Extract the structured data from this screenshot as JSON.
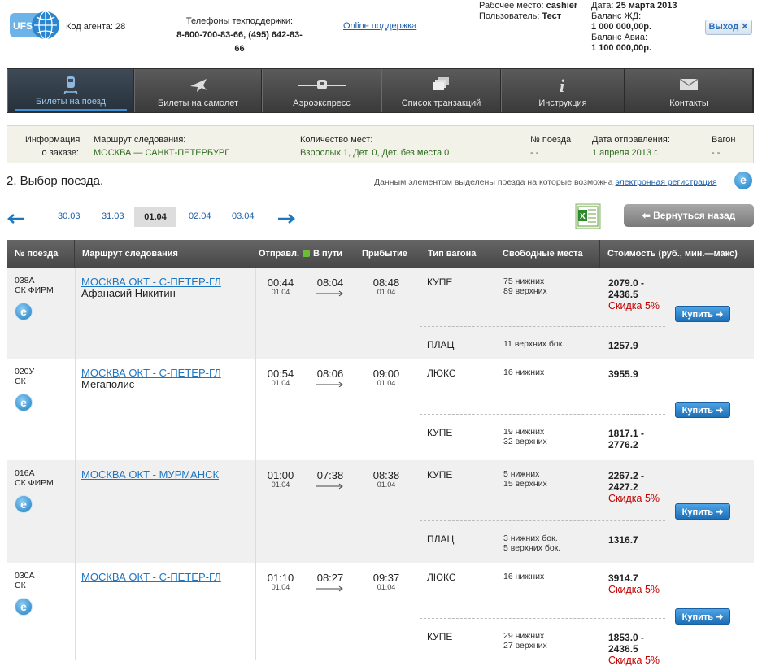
{
  "header": {
    "agent_code": "Код агента: 28",
    "phones_title": "Телефоны техподдержки:",
    "phones": "8-800-700-83-66, (495) 642-83-66",
    "online_support": "Online поддержка",
    "workplace_label": "Рабочее место:",
    "workplace_value": "cashier",
    "user_label": "Пользователь:",
    "user_value": "Тест",
    "date_label": "Дата:",
    "date_value": "25 марта 2013",
    "rail_balance_label": "Баланс ЖД:",
    "rail_balance_value": "1 000 000,00р.",
    "avia_balance_label": "Баланс Авиа:",
    "avia_balance_value": "1 100 000,00р.",
    "exit_label": "Выход",
    "logo_text": "UFS"
  },
  "nav": [
    {
      "label": "Билеты на поезд",
      "icon": "train-icon",
      "active": true
    },
    {
      "label": "Билеты на самолет",
      "icon": "plane-icon",
      "active": false
    },
    {
      "label": "Аэроэкспресс",
      "icon": "aeroexpress-icon",
      "active": false
    },
    {
      "label": "Список транзакций",
      "icon": "transactions-icon",
      "active": false
    },
    {
      "label": "Инструкция",
      "icon": "info-icon",
      "active": false
    },
    {
      "label": "Контакты",
      "icon": "mail-icon",
      "active": false
    }
  ],
  "order_info": {
    "label_line1": "Информация",
    "label_line2": "о заказе:",
    "route_label": "Маршрут следования:",
    "route_value": "МОСКВА — САНКТ-ПЕТЕРБУРГ",
    "seats_label": "Количество мест:",
    "seats_value": "Взрослых 1, Дет. 0, Дет. без места 0",
    "train_label": "№ поезда",
    "train_value": "- -",
    "date_label": "Дата отправления:",
    "date_value": "1 апреля 2013 г.",
    "car_label": "Вагон",
    "car_value": "- -"
  },
  "step_title": "2. Выбор поезда.",
  "note_text": "Данным элементом выделены поезда на которые возможна",
  "note_link": "электронная регистрация",
  "dates": [
    "30.03",
    "31.03",
    "01.04",
    "02.04",
    "03.04"
  ],
  "back_button": "Вернуться назад",
  "columns": [
    "№ поезда",
    "Маршрут следования",
    "Отправл.",
    "В пути",
    "Прибытие",
    "Тип вагона",
    "Свободные места",
    "Стоимость (руб., мин.—макс)"
  ],
  "buy_label": "Купить",
  "trains": [
    {
      "num": "038А",
      "cls": "СК ФИРМ",
      "route": "МОСКВА ОКТ - С-ПЕТЕР-ГЛ",
      "name": "Афанасий Никитин",
      "dep": "00:44",
      "dep_date": "01.04",
      "travel": "08:04",
      "arr": "08:48",
      "arr_date": "01.04",
      "cars": [
        {
          "type": "КУПЕ",
          "seats1": "75 нижних",
          "seats2": "89 верхних",
          "price1": "2079.0 -",
          "price2": "2436.5",
          "discount": "Скидка 5%"
        },
        {
          "type": "ПЛАЦ",
          "seats1": "11 верхних бок.",
          "seats2": "",
          "price1": "1257.9",
          "price2": "",
          "discount": ""
        }
      ]
    },
    {
      "num": "020У",
      "cls": "СК",
      "route": "МОСКВА ОКТ - С-ПЕТЕР-ГЛ",
      "name": "Мегаполис",
      "dep": "00:54",
      "dep_date": "01.04",
      "travel": "08:06",
      "arr": "09:00",
      "arr_date": "01.04",
      "cars": [
        {
          "type": "ЛЮКС",
          "seats1": "16 нижних",
          "seats2": "",
          "price1": "3955.9",
          "price2": "",
          "discount": ""
        },
        {
          "type": "КУПЕ",
          "seats1": "19 нижних",
          "seats2": "32 верхних",
          "price1": "1817.1 -",
          "price2": "2776.2",
          "discount": ""
        }
      ]
    },
    {
      "num": "016А",
      "cls": "СК ФИРМ",
      "route": "МОСКВА ОКТ - МУРМАНСК",
      "name": "",
      "dep": "01:00",
      "dep_date": "01.04",
      "travel": "07:38",
      "arr": "08:38",
      "arr_date": "01.04",
      "cars": [
        {
          "type": "КУПЕ",
          "seats1": "5 нижних",
          "seats2": "15 верхних",
          "price1": "2267.2 -",
          "price2": "2427.2",
          "discount": "Скидка 5%"
        },
        {
          "type": "ПЛАЦ",
          "seats1": "3 нижних бок.",
          "seats2": "5 верхних бок.",
          "price1": "1316.7",
          "price2": "",
          "discount": ""
        }
      ]
    },
    {
      "num": "030А",
      "cls": "СК",
      "route": "МОСКВА ОКТ - С-ПЕТЕР-ГЛ",
      "name": "",
      "dep": "01:10",
      "dep_date": "01.04",
      "travel": "08:27",
      "arr": "09:37",
      "arr_date": "01.04",
      "cars": [
        {
          "type": "ЛЮКС",
          "seats1": "16 нижних",
          "seats2": "",
          "price1": "3914.7",
          "price2": "",
          "discount": "Скидка 5%"
        },
        {
          "type": "КУПЕ",
          "seats1": "29 нижних",
          "seats2": "27 верхних",
          "price1": "1853.0 -",
          "price2": "2436.5",
          "discount": "Скидка 5%"
        }
      ]
    }
  ]
}
